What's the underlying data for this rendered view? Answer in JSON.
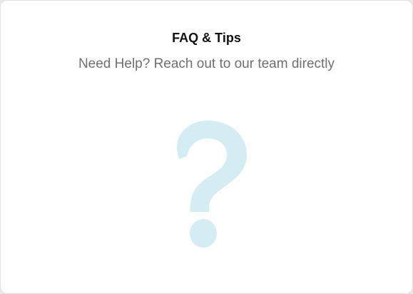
{
  "faq": {
    "title": "FAQ & Tips",
    "subtitle": "Need Help? Reach out to our team directly",
    "illustration_icon": "question-mark-icon",
    "illustration_color": "#d4ecf2"
  }
}
